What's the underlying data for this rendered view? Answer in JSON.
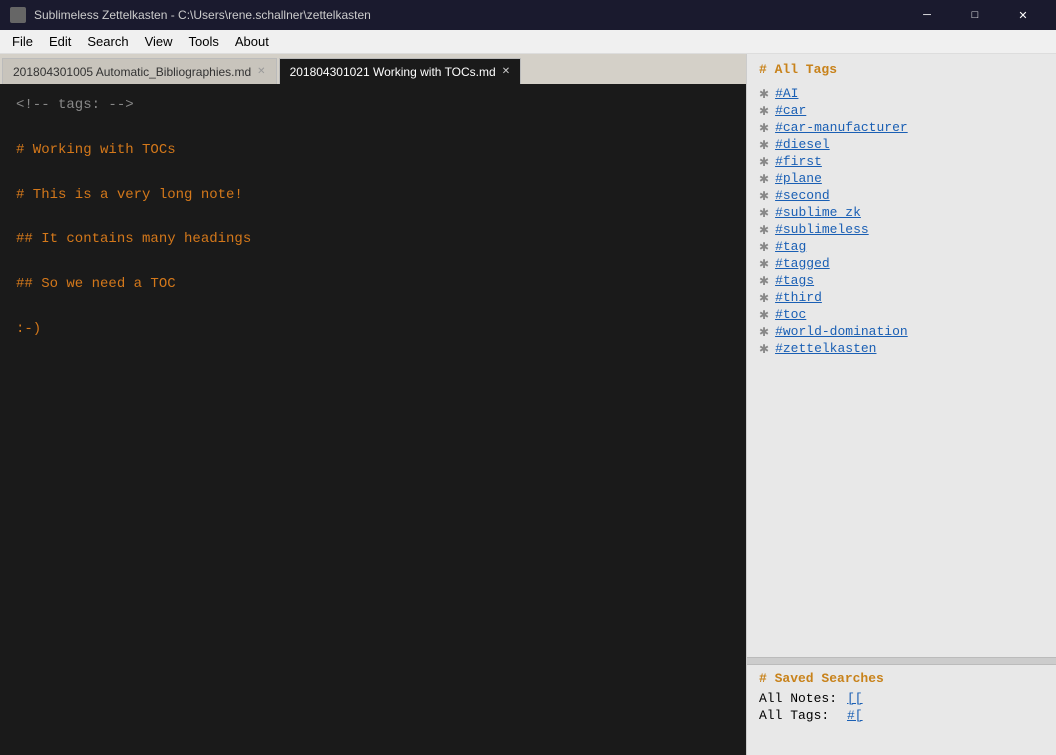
{
  "titlebar": {
    "app_icon": "app-icon",
    "title": "Sublimeless Zettelkasten - C:\\Users\\rene.schallner\\zettelkasten",
    "minimize_label": "─",
    "maximize_label": "□",
    "close_label": "✕"
  },
  "menubar": {
    "items": [
      {
        "label": "File",
        "id": "file"
      },
      {
        "label": "Edit",
        "id": "edit"
      },
      {
        "label": "Search",
        "id": "search"
      },
      {
        "label": "View",
        "id": "view"
      },
      {
        "label": "Tools",
        "id": "tools"
      },
      {
        "label": "About",
        "id": "about"
      }
    ]
  },
  "tabs": [
    {
      "label": "201804301005 Automatic_Bibliographies.md",
      "active": false,
      "id": "tab1"
    },
    {
      "label": "201804301021 Working with TOCs.md",
      "active": true,
      "id": "tab2"
    }
  ],
  "editor": {
    "lines": [
      {
        "type": "comment",
        "text": "<!-- tags: -->"
      },
      {
        "type": "empty",
        "text": ""
      },
      {
        "type": "h1",
        "text": "# Working with TOCs"
      },
      {
        "type": "empty",
        "text": ""
      },
      {
        "type": "h1",
        "text": "# This is a very long note!"
      },
      {
        "type": "empty",
        "text": ""
      },
      {
        "type": "h2",
        "text": "## It contains many headings"
      },
      {
        "type": "empty",
        "text": ""
      },
      {
        "type": "h2",
        "text": "## So we need a TOC"
      },
      {
        "type": "empty",
        "text": ""
      },
      {
        "type": "normal",
        "text": ":-)"
      },
      {
        "type": "empty",
        "text": ""
      }
    ]
  },
  "tags_panel": {
    "title": "# All Tags",
    "tags": [
      "#AI",
      "#car",
      "#car-manufacturer",
      "#diesel",
      "#first",
      "#plane",
      "#second",
      "#sublime_zk",
      "#sublimeless",
      "#tag",
      "#tagged",
      "#tags",
      "#third",
      "#toc",
      "#world-domination",
      "#zettelkasten"
    ]
  },
  "saved_searches": {
    "title": "# Saved Searches",
    "items": [
      {
        "label": "All Notes:",
        "link": "[["
      },
      {
        "label": "All Tags:",
        "link": "#["
      }
    ]
  }
}
